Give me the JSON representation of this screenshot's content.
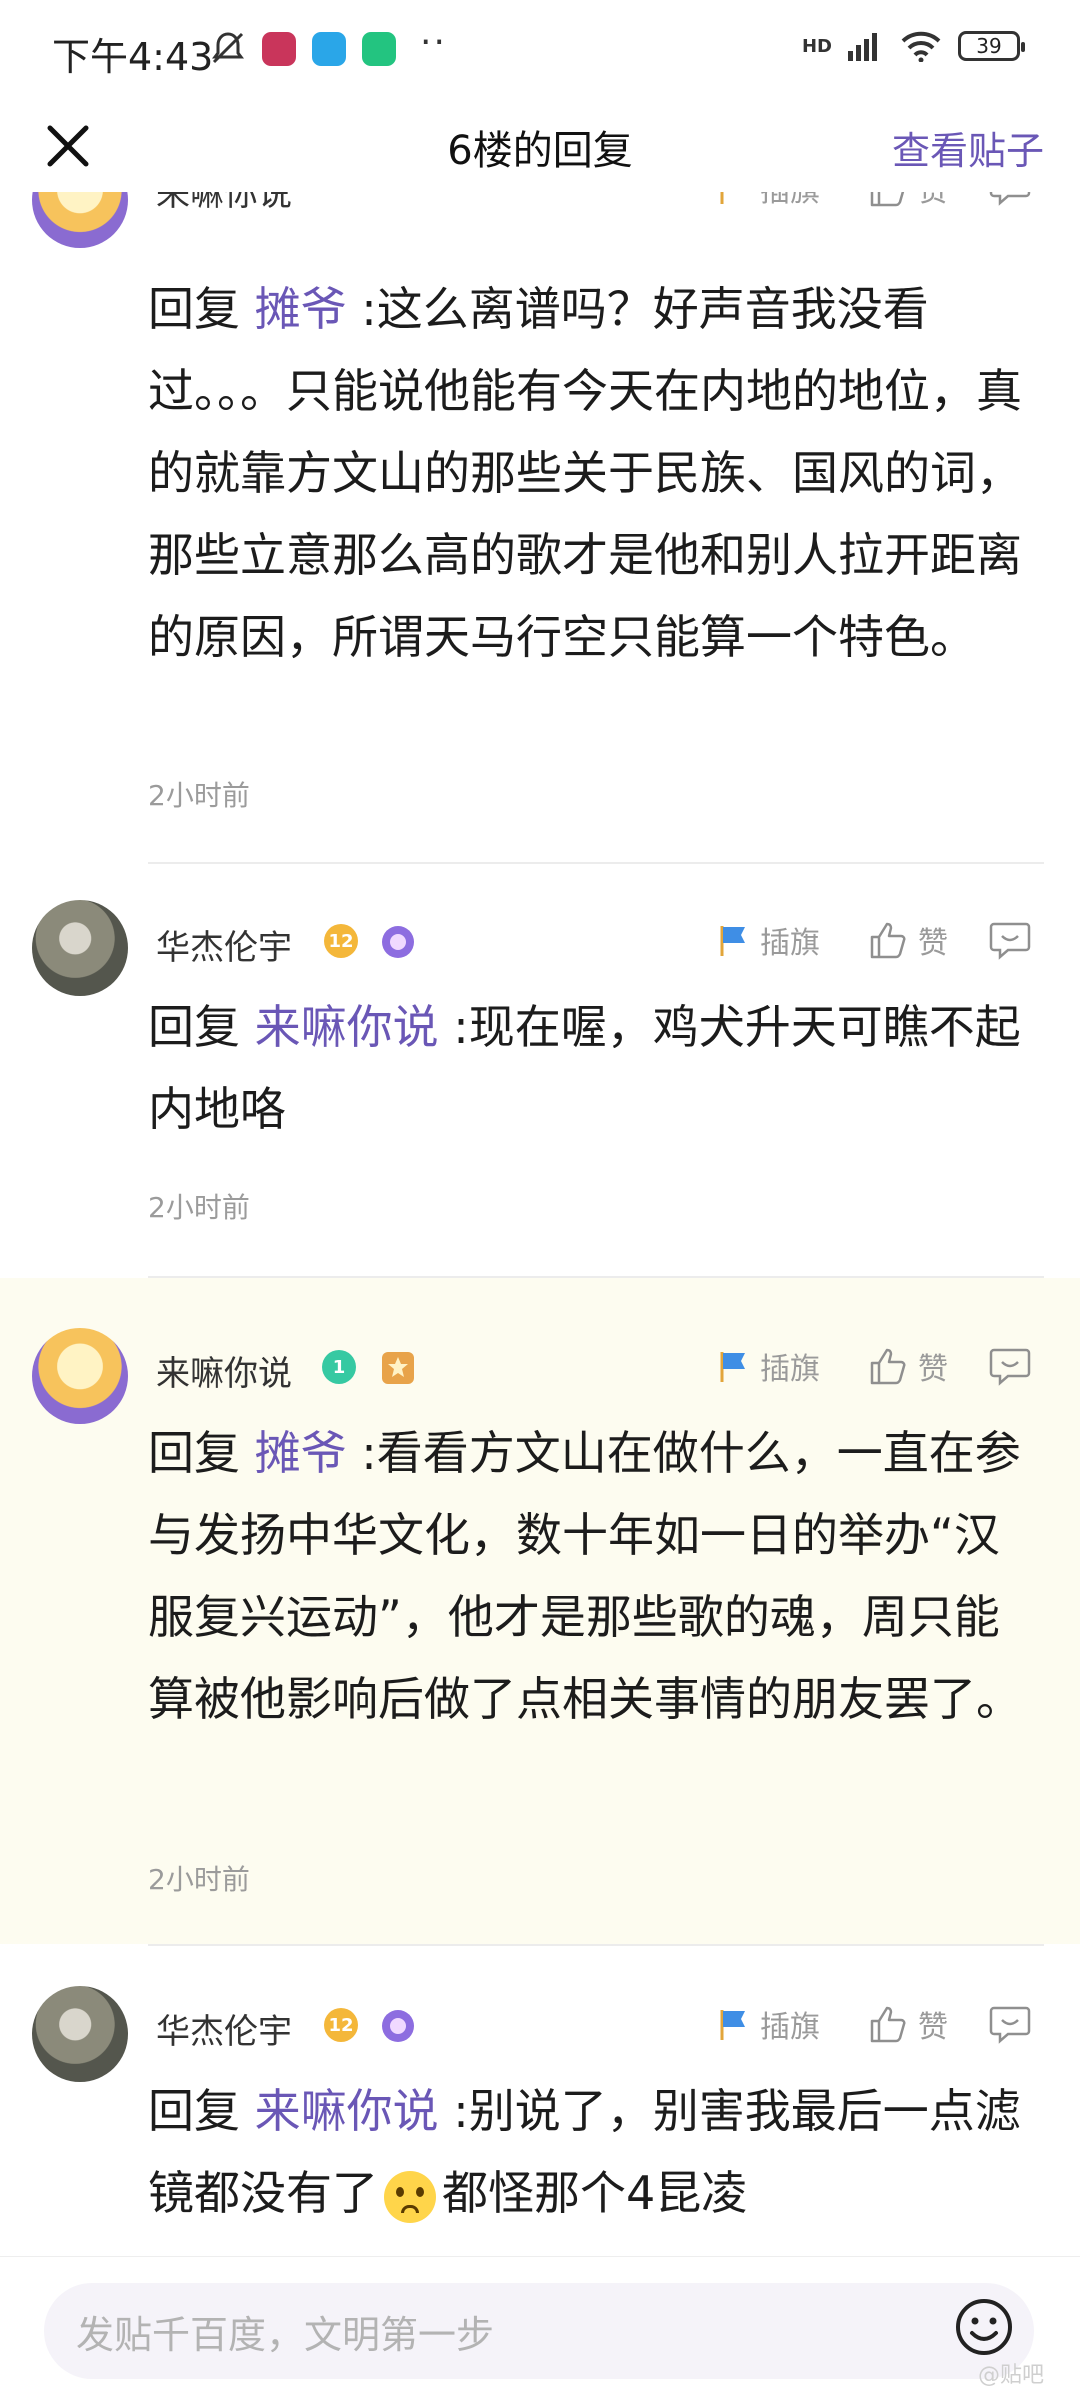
{
  "status_bar": {
    "time": "下午4:43",
    "network": "HD",
    "battery": "39",
    "more": "··"
  },
  "nav": {
    "title": "6楼的回复",
    "right_action": "查看贴子"
  },
  "actions": {
    "flag": "插旗",
    "like": "赞"
  },
  "replies": [
    {
      "user": "来嘛你说",
      "prefix": "回复",
      "mention": "摊爷",
      "text": " :这么离谱吗？好声音我没看过。。。只能说他能有今天在内地的地位，真的就靠方文山的那些关于民族、国风的词，那些立意那么高的歌才是他和别人拉开距离的原因，所谓天马行空只能算一个特色。",
      "time": "2小时前"
    },
    {
      "user": "华杰伦宇",
      "level": "12",
      "prefix": "回复",
      "mention": "来嘛你说",
      "text": " :现在喔，鸡犬升天可瞧不起内地咯",
      "time": "2小时前"
    },
    {
      "user": "来嘛你说",
      "level": "1",
      "prefix": "回复",
      "mention": "摊爷",
      "text": " :看看方文山在做什么，一直在参与发扬中华文化，数十年如一日的举办“汉服复兴运动”，他才是那些歌的魂，周只能算被他影响后做了点相关事情的朋友罢了。",
      "time": "2小时前"
    },
    {
      "user": "华杰伦宇",
      "level": "12",
      "prefix": "回复",
      "mention": "来嘛你说",
      "text": " :别说了，别害我最后一点滤镜都没有了",
      "text_after_emoji": "都怪那个4昆凌"
    }
  ],
  "input": {
    "placeholder": "发贴千百度，文明第一步"
  },
  "watermark": "@贴吧",
  "colors": {
    "accent": "#6a57b6",
    "highlight_bg": "#fdfcf0",
    "level_gold": "#f4b73a",
    "level_green": "#36c9a2"
  }
}
